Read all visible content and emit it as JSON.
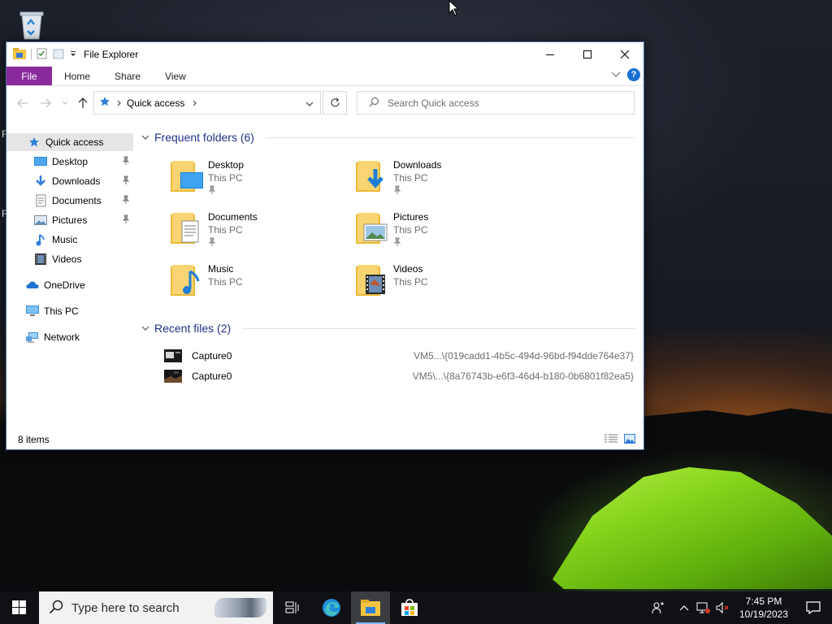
{
  "window": {
    "title": "File Explorer"
  },
  "ribbon": {
    "tabs": [
      "File",
      "Home",
      "Share",
      "View"
    ]
  },
  "address": {
    "location": "Quick access",
    "search_placeholder": "Search Quick access"
  },
  "nav": {
    "quick_access": "Quick access",
    "pinned": [
      {
        "label": "Desktop",
        "icon": "desktop-icon",
        "pinned": true
      },
      {
        "label": "Downloads",
        "icon": "downloads-icon",
        "pinned": true
      },
      {
        "label": "Documents",
        "icon": "documents-icon",
        "pinned": true
      },
      {
        "label": "Pictures",
        "icon": "pictures-icon",
        "pinned": true
      },
      {
        "label": "Music",
        "icon": "music-icon",
        "pinned": false
      },
      {
        "label": "Videos",
        "icon": "videos-icon",
        "pinned": false
      }
    ],
    "onedrive": "OneDrive",
    "this_pc": "This PC",
    "network": "Network"
  },
  "frequent": {
    "header": "Frequent folders (6)",
    "folders": [
      {
        "name": "Desktop",
        "location": "This PC",
        "pinned": true
      },
      {
        "name": "Downloads",
        "location": "This PC",
        "pinned": true
      },
      {
        "name": "Documents",
        "location": "This PC",
        "pinned": true
      },
      {
        "name": "Pictures",
        "location": "This PC",
        "pinned": true
      },
      {
        "name": "Music",
        "location": "This PC",
        "pinned": false
      },
      {
        "name": "Videos",
        "location": "This PC",
        "pinned": false
      }
    ]
  },
  "recent": {
    "header": "Recent files (2)",
    "files": [
      {
        "name": "Capture0",
        "path": "VM5...\\{019cadd1-4b5c-494d-96bd-f94dde764e37}"
      },
      {
        "name": "Capture0",
        "path": "VM5\\...\\{8a76743b-e6f3-46d4-b180-0b6801f82ea5}"
      }
    ]
  },
  "status": {
    "items": "8 items"
  },
  "taskbar": {
    "search_placeholder": "Type here to search",
    "time": "7:45 PM",
    "date": "10/19/2023"
  },
  "desktop": {
    "fragments": [
      "R",
      "F"
    ]
  },
  "colors": {
    "file_tab": "#8a2a9c",
    "section_header": "#1e3287",
    "accent": "#1a6fd6",
    "tent": "#86d41c"
  }
}
